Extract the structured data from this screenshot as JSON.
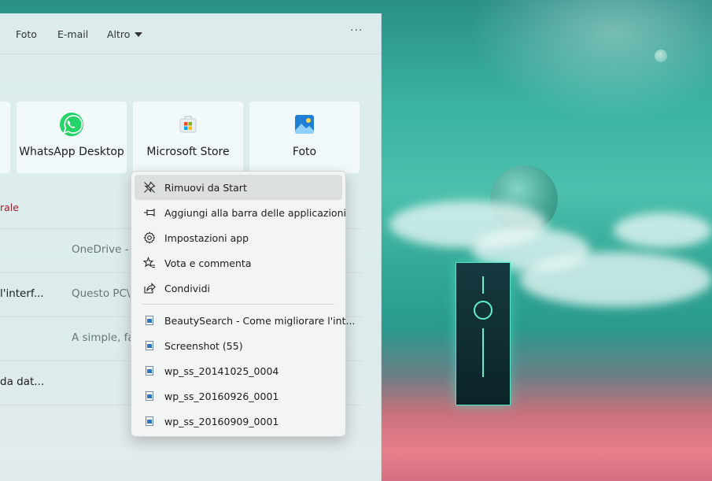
{
  "nav": {
    "items": [
      "Foto",
      "E-mail"
    ],
    "more_label": "Altro",
    "overflow": "···"
  },
  "tiles": [
    {
      "label": "WhatsApp Desktop",
      "icon": "whatsapp-icon"
    },
    {
      "label": "Microsoft Store",
      "icon": "store-icon"
    },
    {
      "label": "Foto",
      "icon": "photos-icon"
    }
  ],
  "section_label": "rale",
  "recent": [
    {
      "name": "",
      "source": "OneDrive -"
    },
    {
      "name": "l'interf...",
      "source": "Questo PC\\"
    },
    {
      "name": "",
      "source": "A simple, fa"
    },
    {
      "name": "da dat...",
      "source": ""
    }
  ],
  "context_menu": {
    "actions": [
      {
        "label": "Rimuovi da Start",
        "icon": "unpin-icon",
        "hover": true
      },
      {
        "label": "Aggiungi alla barra delle applicazioni",
        "icon": "pin-taskbar-icon"
      },
      {
        "label": "Impostazioni app",
        "icon": "gear-icon"
      },
      {
        "label": "Vota e commenta",
        "icon": "star-review-icon"
      },
      {
        "label": "Condividi",
        "icon": "share-icon"
      }
    ],
    "files": [
      {
        "label": "BeautySearch - Come migliorare l'int..."
      },
      {
        "label": "Screenshot (55)"
      },
      {
        "label": "wp_ss_20141025_0004"
      },
      {
        "label": "wp_ss_20160926_0001"
      },
      {
        "label": "wp_ss_20160909_0001"
      }
    ]
  },
  "colors": {
    "accent_red": "#a01f2c",
    "whatsapp_green": "#25d366",
    "monolith_glow": "#5ff0d3"
  }
}
